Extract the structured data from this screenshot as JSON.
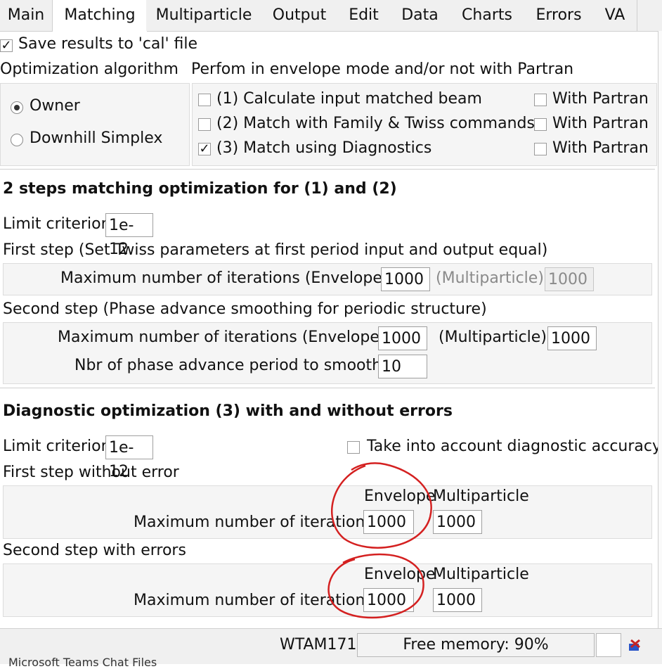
{
  "tabs": [
    "Main",
    "Matching",
    "Multiparticle",
    "Output",
    "Edit",
    "Data",
    "Charts",
    "Errors",
    "VA"
  ],
  "save_results": {
    "label": "Save results to 'cal' file",
    "checked": true
  },
  "algo": {
    "title": "Optimization algorithm",
    "options": [
      "Owner",
      "Downhill Simplex"
    ],
    "selected": "Owner"
  },
  "envelope": {
    "title": "Perfom in envelope mode and/or not with Partran",
    "items": [
      {
        "label": "(1) Calculate input matched beam",
        "checked": false,
        "partran": "With Partran",
        "partran_checked": false
      },
      {
        "label": "(2) Match with Family & Twiss commands",
        "checked": false,
        "partran": "With Partran",
        "partran_checked": false
      },
      {
        "label": "(3) Match using Diagnostics",
        "checked": true,
        "partran": "With Partran",
        "partran_checked": false
      }
    ]
  },
  "two_steps": {
    "title": "2 steps matching optimization for (1) and (2)",
    "limit_label": "Limit criterion",
    "limit_value": "1e-12",
    "first_title": "First step (Set Twiss parameters at first period input and output equal)",
    "first_max_label": "Maximum number of iterations (Envelope)",
    "first_env_value": "1000",
    "first_multi_label": "(Multiparticle)",
    "first_multi_value": "1000",
    "second_title": "Second step (Phase advance smoothing for periodic structure)",
    "second_max_label": "Maximum number of iterations (Envelope)",
    "second_env_value": "1000",
    "second_multi_label": "(Multiparticle)",
    "second_multi_value": "1000",
    "nbr_label": "Nbr of phase advance period to smooth",
    "nbr_value": "10"
  },
  "diag": {
    "title": "Diagnostic optimization (3) with and without errors",
    "limit_label": "Limit criterion",
    "limit_value": "1e-12",
    "accuracy_label": "Take into account diagnostic accuracy",
    "accuracy_checked": false,
    "first_title": "First step without error",
    "second_title": "Second step with errors",
    "envelope_header": "Envelope",
    "multi_header": "Multiparticle",
    "max_label": "Maximum number of iterations",
    "first_env_value": "1000",
    "first_multi_value": "1000",
    "second_env_value": "1000",
    "second_multi_value": "1000"
  },
  "status": {
    "host": "WTAM171",
    "memory": "Free memory: 90%",
    "taskbar_fragment": "Microsoft Teams Chat Files"
  },
  "colors": {
    "annotation": "#d42020",
    "accent": "#333333"
  }
}
